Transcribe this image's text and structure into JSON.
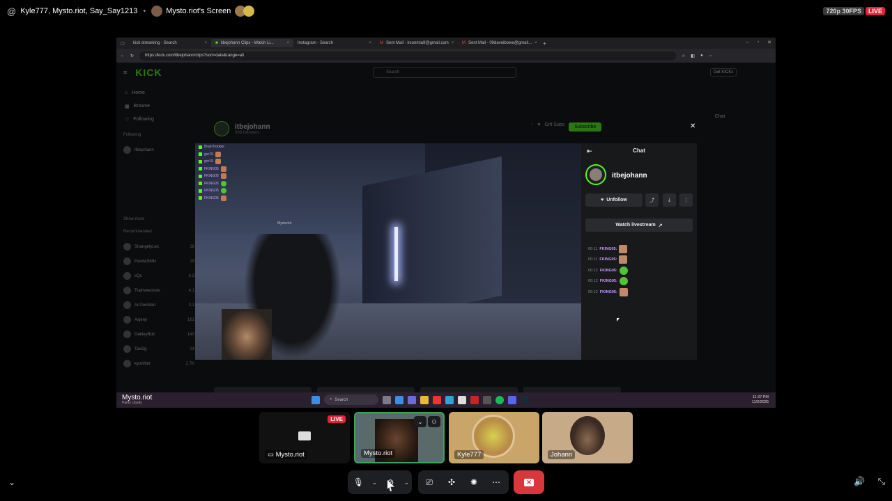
{
  "topbar": {
    "participants": "Kyle777, Mysto.riot, Say_Say1213",
    "screen_title": "Mysto.riot's Screen",
    "quality": "720p 30FPS",
    "live": "LIVE"
  },
  "browser": {
    "tabs": [
      {
        "label": "kick streaming - Search"
      },
      {
        "label": "itbejohann Clips - Watch Li..."
      },
      {
        "label": "Instagram - Search"
      },
      {
        "label": "Sent Mail - irsonmia9@gmail.com"
      },
      {
        "label": "Sent Mail - 09daveibowe@gmail..."
      }
    ],
    "url": "https://kick.com/itbejohann/clips?sort=date&range=all"
  },
  "kick": {
    "logo": "KICK",
    "search_placeholder": "Search",
    "get_kicks": "Get KICKs",
    "nav": [
      {
        "label": "Home"
      },
      {
        "label": "Browse"
      },
      {
        "label": "Following"
      }
    ],
    "following_header": "Following",
    "show_more": "Show more",
    "recommended_header": "Recommended",
    "recommended": [
      {
        "name": "StrangelyLex",
        "viewers": "28"
      },
      {
        "name": "PandaSkills",
        "viewers": "19"
      },
      {
        "name": "xQc",
        "viewers": "6.3"
      },
      {
        "name": "Trainwreckstv",
        "viewers": "4.1"
      },
      {
        "name": "Ac7ionMan",
        "viewers": "3.1"
      },
      {
        "name": "Asjeny",
        "viewers": "161"
      },
      {
        "name": "OakleyBoll",
        "viewers": "140"
      },
      {
        "name": "Taxi2g",
        "viewers": "24"
      },
      {
        "name": "kyontbot",
        "viewers": "2.7K"
      }
    ],
    "channel_name": "itbejohann",
    "channel_followers": "308 followers",
    "gift_subs": "Gift Subs",
    "subscribe": "Subscribe",
    "right_chat_title": "Chat"
  },
  "clip_modal": {
    "overlay_chat": [
      {
        "name": "BrainTroober"
      },
      {
        "name": "gor19"
      },
      {
        "name": "gor19"
      },
      {
        "name": "FKING05"
      },
      {
        "name": "FKING05"
      },
      {
        "name": "FKING05"
      },
      {
        "name": "FKING05"
      },
      {
        "name": "FKING05"
      }
    ],
    "game_tag": "Mystoriot",
    "panel_title": "Chat",
    "streamer": "itbejohann",
    "unfollow": "Unfollow",
    "watch_livestream": "Watch livestream",
    "chat_lines": [
      {
        "time": "00:11",
        "user": "FKING05:"
      },
      {
        "time": "00:11",
        "user": "FKING05:"
      },
      {
        "time": "00:12",
        "user": "FKING05:"
      },
      {
        "time": "00:12",
        "user": "FKING05:"
      },
      {
        "time": "00:12",
        "user": "FKING05:"
      }
    ]
  },
  "taskbar": {
    "weather_user": "Mysto.riot",
    "weather_sub": "Partly cloudy",
    "search": "Search",
    "time": "11:37 PM",
    "date": "11/2/2025"
  },
  "tiles": [
    {
      "name": "Mysto.riot",
      "badge": "LIVE"
    },
    {
      "name": "Mysto.riot"
    },
    {
      "name": "Kyle777"
    },
    {
      "name": "Johann"
    }
  ]
}
